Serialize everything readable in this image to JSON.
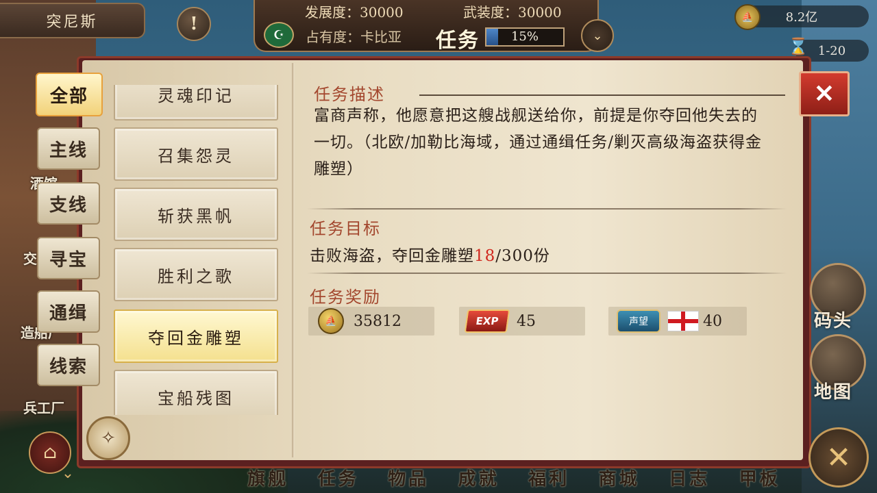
{
  "header": {
    "city_name": "突尼斯",
    "alert_symbol": "!",
    "development_label": "发展度：30000",
    "armament_label": "武装度：30000",
    "occupancy_label": "占有度：卡比亚",
    "task_title": "任务",
    "task_progress_text": "15%",
    "task_progress_fraction": 0.15,
    "faction_flag_symbol": "☪",
    "expand_symbol": "⌄"
  },
  "resources": {
    "gold": "8.2亿",
    "time": "1-20",
    "time_icon": "hourglass-icon"
  },
  "background_labels": {
    "tavern": "酒馆",
    "trade": "交",
    "shipyard": "造船厂",
    "arsenal": "兵工厂"
  },
  "categories": [
    {
      "label": "全部",
      "active": true
    },
    {
      "label": "主线",
      "active": false
    },
    {
      "label": "支线",
      "active": false
    },
    {
      "label": "寻宝",
      "active": false
    },
    {
      "label": "通缉",
      "active": false
    },
    {
      "label": "线索",
      "active": false
    }
  ],
  "quests": [
    {
      "label": "灵魂印记",
      "active": false
    },
    {
      "label": "召集怨灵",
      "active": false
    },
    {
      "label": "斩获黑帆",
      "active": false
    },
    {
      "label": "胜利之歌",
      "active": false
    },
    {
      "label": "夺回金雕塑",
      "active": true
    },
    {
      "label": "宝船残图",
      "active": false
    }
  ],
  "detail": {
    "description_title": "任务描述",
    "description": "富商声称，他愿意把这艘战舰送给你，前提是你夺回他失去的一切。（北欧/加勒比海域，通过通缉任务/剿灭高级海盗获得金雕塑）",
    "goal_title": "任务目标",
    "goal_prefix": "击败海盗，夺回金雕塑",
    "goal_current": "18",
    "goal_suffix": "/300份",
    "reward_title": "任务奖励",
    "rewards": {
      "gold": "35812",
      "exp_badge": "EXP",
      "exp": "45",
      "reputation_badge": "声望",
      "reputation": "40"
    }
  },
  "close_symbol": "✕",
  "right_buttons": {
    "dock": "码头",
    "map": "地图"
  },
  "bottom_nav": [
    "旗舰",
    "任务",
    "物品",
    "成就",
    "福利",
    "商城",
    "日志",
    "甲板"
  ],
  "colors": {
    "accent_red": "#a3472e",
    "highlight_number": "#d0281e",
    "active_tab": "#f2d27a"
  }
}
